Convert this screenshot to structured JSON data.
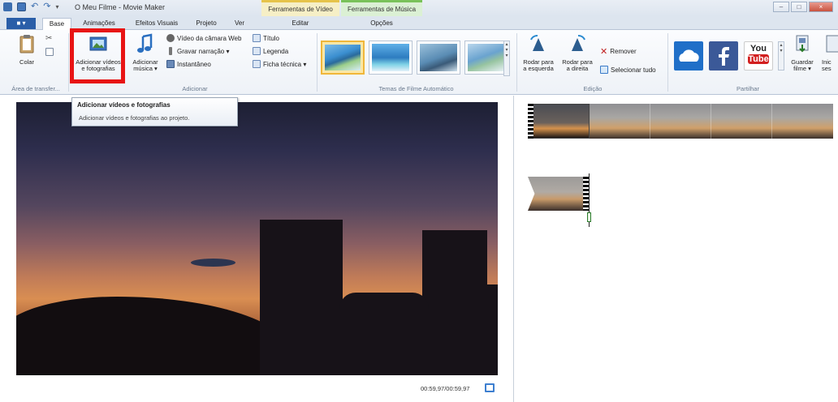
{
  "window": {
    "title": "O Meu Filme - Movie Maker",
    "context_video": "Ferramentas de Vídeo",
    "context_music": "Ferramentas de Música",
    "min_label": "–",
    "max_label": "□",
    "close_label": "×"
  },
  "tabs": {
    "file": "■ ▾",
    "items": [
      "Base",
      "Animações",
      "Efeitos Visuais",
      "Projeto",
      "Ver"
    ],
    "edit": "Editar",
    "options": "Opções"
  },
  "ribbon": {
    "clipboard": {
      "paste": "Colar",
      "group": "Área de transfer..."
    },
    "add": {
      "add_videos_line1": "Adicionar vídeos",
      "add_videos_line2": "e fotografias",
      "add_music_line1": "Adicionar",
      "add_music_line2": "música ▾",
      "webcam": "Vídeo da câmara Web",
      "narration": "Gravar narração ▾",
      "snapshot": "Instantâneo",
      "title": "Título",
      "caption": "Legenda",
      "credits": "Ficha técnica ▾",
      "group": "Adicionar"
    },
    "themes": {
      "group": "Temas de Filme Automático"
    },
    "editing": {
      "rotate_left_1": "Rodar para",
      "rotate_left_2": "a esquerda",
      "rotate_right_1": "Rodar para",
      "rotate_right_2": "a direita",
      "remove": "Remover",
      "select_all": "Selecionar tudo",
      "group": "Edição"
    },
    "share": {
      "youtube_top": "You",
      "youtube_bottom": "Tube",
      "save_1": "Guardar",
      "save_2": "filme ▾",
      "signin_1": "Inic",
      "signin_2": "ses",
      "group": "Partilhar"
    }
  },
  "tooltip": {
    "title": "Adicionar vídeos e fotografias",
    "body": "Adicionar vídeos e fotografias ao projeto."
  },
  "preview": {
    "time": "00:59,97/00:59,97"
  },
  "colors": {
    "accent": "#2a5ea8",
    "highlight": "#e81414",
    "context_video": "#e6c34a",
    "context_music": "#79c25a"
  }
}
